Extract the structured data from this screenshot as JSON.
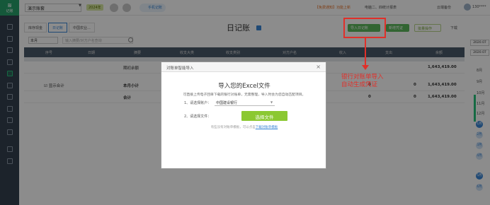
{
  "app": {
    "logo_label": "记账",
    "company": "演示账套",
    "badge": "2024年",
    "mobile_pill": "手机记账",
    "promo": "【免费通知】功能上新",
    "link2": "电脑二、四统计报表",
    "cloud": "云端备份",
    "user": "130****"
  },
  "tabs": [
    {
      "label": "库存现金"
    },
    {
      "label": "日记账"
    },
    {
      "label": "中国农业..."
    }
  ],
  "page_title": "日记账",
  "toolbar": {
    "import_label": "导入日记账",
    "new_label": "新增凭证",
    "batch_label": "批量操作",
    "download_label": "下载"
  },
  "filter": {
    "value": "本月",
    "search_placeholder": "输入摘要/对方户名查询"
  },
  "table": {
    "headers": [
      "序号",
      "日期",
      "摘要",
      "收支大类",
      "收支类别",
      "对方户名",
      "收入",
      "支出",
      "余额"
    ],
    "rows": [
      {
        "summary": "期初余额",
        "income": "",
        "expense": "",
        "balance": "1,643,419.00"
      },
      {
        "checkbox_label": "显示合计",
        "summary": "本月小计",
        "income": "0",
        "expense": "0",
        "balance": "1,643,419.00"
      },
      {
        "summary": "合计",
        "income": "0",
        "expense": "0",
        "balance": "1,643,419.00"
      }
    ]
  },
  "date_rail": {
    "dates": [
      "2020.07",
      "2020.07"
    ],
    "months": [
      "8月",
      "9月",
      "10月",
      "11月",
      "12月"
    ],
    "dots": [
      "1月",
      "2月",
      "3月",
      "4月",
      "5月",
      "6月"
    ]
  },
  "annotation": {
    "text": "银行对账单导入\n自动生成凭证"
  },
  "modal": {
    "header": "对账单智能导入",
    "title": "导入您的Excel文件",
    "description": "可直接上传电子回单下载的银行对账单，无需整理，导入时会为您自动匹配项目。",
    "step1_label": "1、请选择账户：",
    "account_value": "中国建设银行",
    "step2_label": "2、请选择文件：",
    "choose_button": "选择文件",
    "footer_text": "有些没有对账单模板，可以点击",
    "footer_link": "下载对账单模板"
  }
}
